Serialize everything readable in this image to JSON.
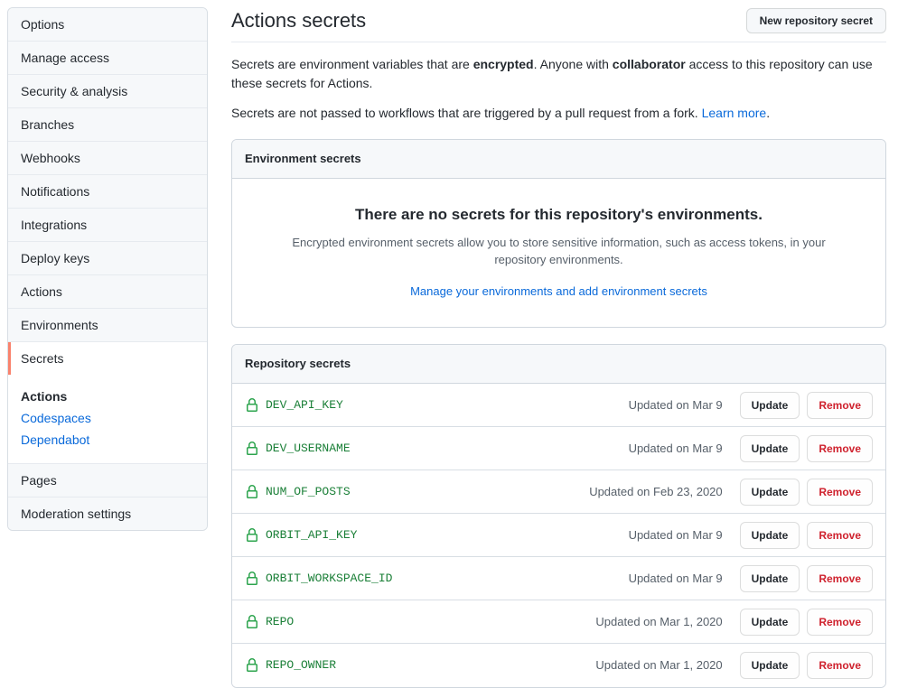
{
  "sidebar": {
    "items": [
      {
        "label": "Options",
        "selected": false
      },
      {
        "label": "Manage access",
        "selected": false
      },
      {
        "label": "Security & analysis",
        "selected": false
      },
      {
        "label": "Branches",
        "selected": false
      },
      {
        "label": "Webhooks",
        "selected": false
      },
      {
        "label": "Notifications",
        "selected": false
      },
      {
        "label": "Integrations",
        "selected": false
      },
      {
        "label": "Deploy keys",
        "selected": false
      },
      {
        "label": "Actions",
        "selected": false
      },
      {
        "label": "Environments",
        "selected": false
      },
      {
        "label": "Secrets",
        "selected": true
      }
    ],
    "sub_items": [
      {
        "label": "Actions",
        "current": true
      },
      {
        "label": "Codespaces",
        "current": false
      },
      {
        "label": "Dependabot",
        "current": false
      }
    ],
    "tail_items": [
      {
        "label": "Pages"
      },
      {
        "label": "Moderation settings"
      }
    ]
  },
  "header": {
    "title": "Actions secrets",
    "new_secret_button": "New repository secret"
  },
  "intro": {
    "line1_part1": "Secrets are environment variables that are ",
    "line1_bold1": "encrypted",
    "line1_part2": ". Anyone with ",
    "line1_bold2": "collaborator",
    "line1_part3": " access to this repository can use these secrets for Actions.",
    "line2_text": "Secrets are not passed to workflows that are triggered by a pull request from a fork. ",
    "line2_link": "Learn more",
    "line2_period": "."
  },
  "environment_secrets": {
    "header": "Environment secrets",
    "empty_title": "There are no secrets for this repository's environments.",
    "empty_desc": "Encrypted environment secrets allow you to store sensitive information, such as access tokens, in your repository environments.",
    "empty_link": "Manage your environments and add environment secrets"
  },
  "repository_secrets": {
    "header": "Repository secrets",
    "update_label": "Update",
    "remove_label": "Remove",
    "rows": [
      {
        "name": "DEV_API_KEY",
        "updated": "Updated on Mar 9"
      },
      {
        "name": "DEV_USERNAME",
        "updated": "Updated on Mar 9"
      },
      {
        "name": "NUM_OF_POSTS",
        "updated": "Updated on Feb 23, 2020"
      },
      {
        "name": "ORBIT_API_KEY",
        "updated": "Updated on Mar 9"
      },
      {
        "name": "ORBIT_WORKSPACE_ID",
        "updated": "Updated on Mar 9"
      },
      {
        "name": "REPO",
        "updated": "Updated on Mar 1, 2020"
      },
      {
        "name": "REPO_OWNER",
        "updated": "Updated on Mar 1, 2020"
      }
    ]
  },
  "icons": {
    "lock": "lock-icon"
  },
  "colors": {
    "accent": "#0969da",
    "secret_green": "#1a7f37",
    "danger": "#cf222e",
    "selected_marker": "#f9826c"
  }
}
